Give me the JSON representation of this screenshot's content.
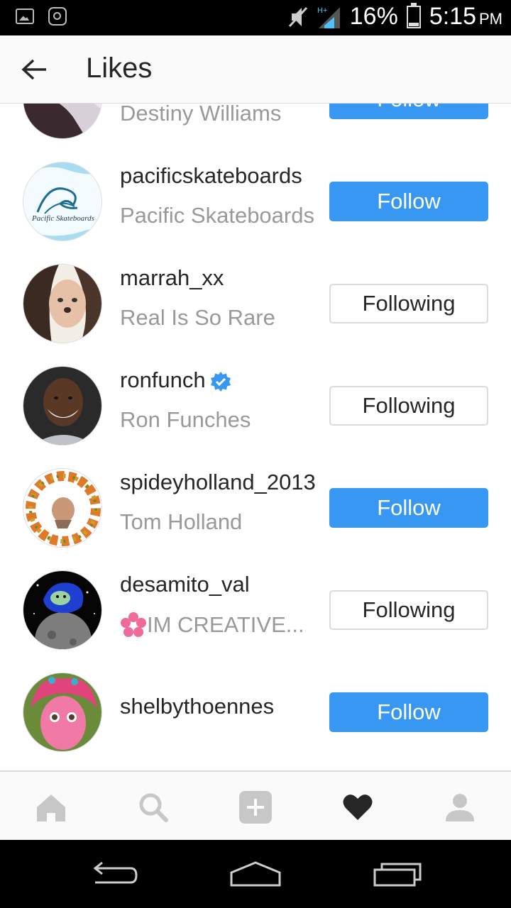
{
  "status_bar": {
    "battery": "16%",
    "time": "5:15",
    "ampm": "PM",
    "network": "H+"
  },
  "header": {
    "title": "Likes"
  },
  "users": [
    {
      "username": "",
      "full_name": "Destiny Williams",
      "button": "Follow",
      "following": false,
      "verified": false
    },
    {
      "username": "pacificskateboards",
      "full_name": "Pacific Skateboards",
      "button": "Follow",
      "following": false,
      "verified": false
    },
    {
      "username": "marrah_xx",
      "full_name": "Real Is So Rare",
      "button": "Following",
      "following": true,
      "verified": false
    },
    {
      "username": "ronfunch",
      "full_name": "Ron Funches",
      "button": "Following",
      "following": true,
      "verified": true
    },
    {
      "username": "spideyholland_2013",
      "full_name": "Tom Holland",
      "button": "Follow",
      "following": false,
      "verified": false
    },
    {
      "username": "desamito_val",
      "full_name": "IM CREATIVE...",
      "button": "Following",
      "following": true,
      "verified": false
    },
    {
      "username": "shelbythoennes",
      "full_name": "",
      "button": "Follow",
      "following": false,
      "verified": false
    }
  ],
  "colors": {
    "accent": "#3897f0",
    "text_primary": "#262626",
    "text_secondary": "#999999",
    "border": "#dbdbdb"
  },
  "avatar_logo_text": "Pacific Skateboards",
  "bottom_nav": {
    "items": [
      "home-icon",
      "search-icon",
      "add-icon",
      "heart-icon",
      "profile-icon"
    ],
    "active": "heart-icon"
  }
}
